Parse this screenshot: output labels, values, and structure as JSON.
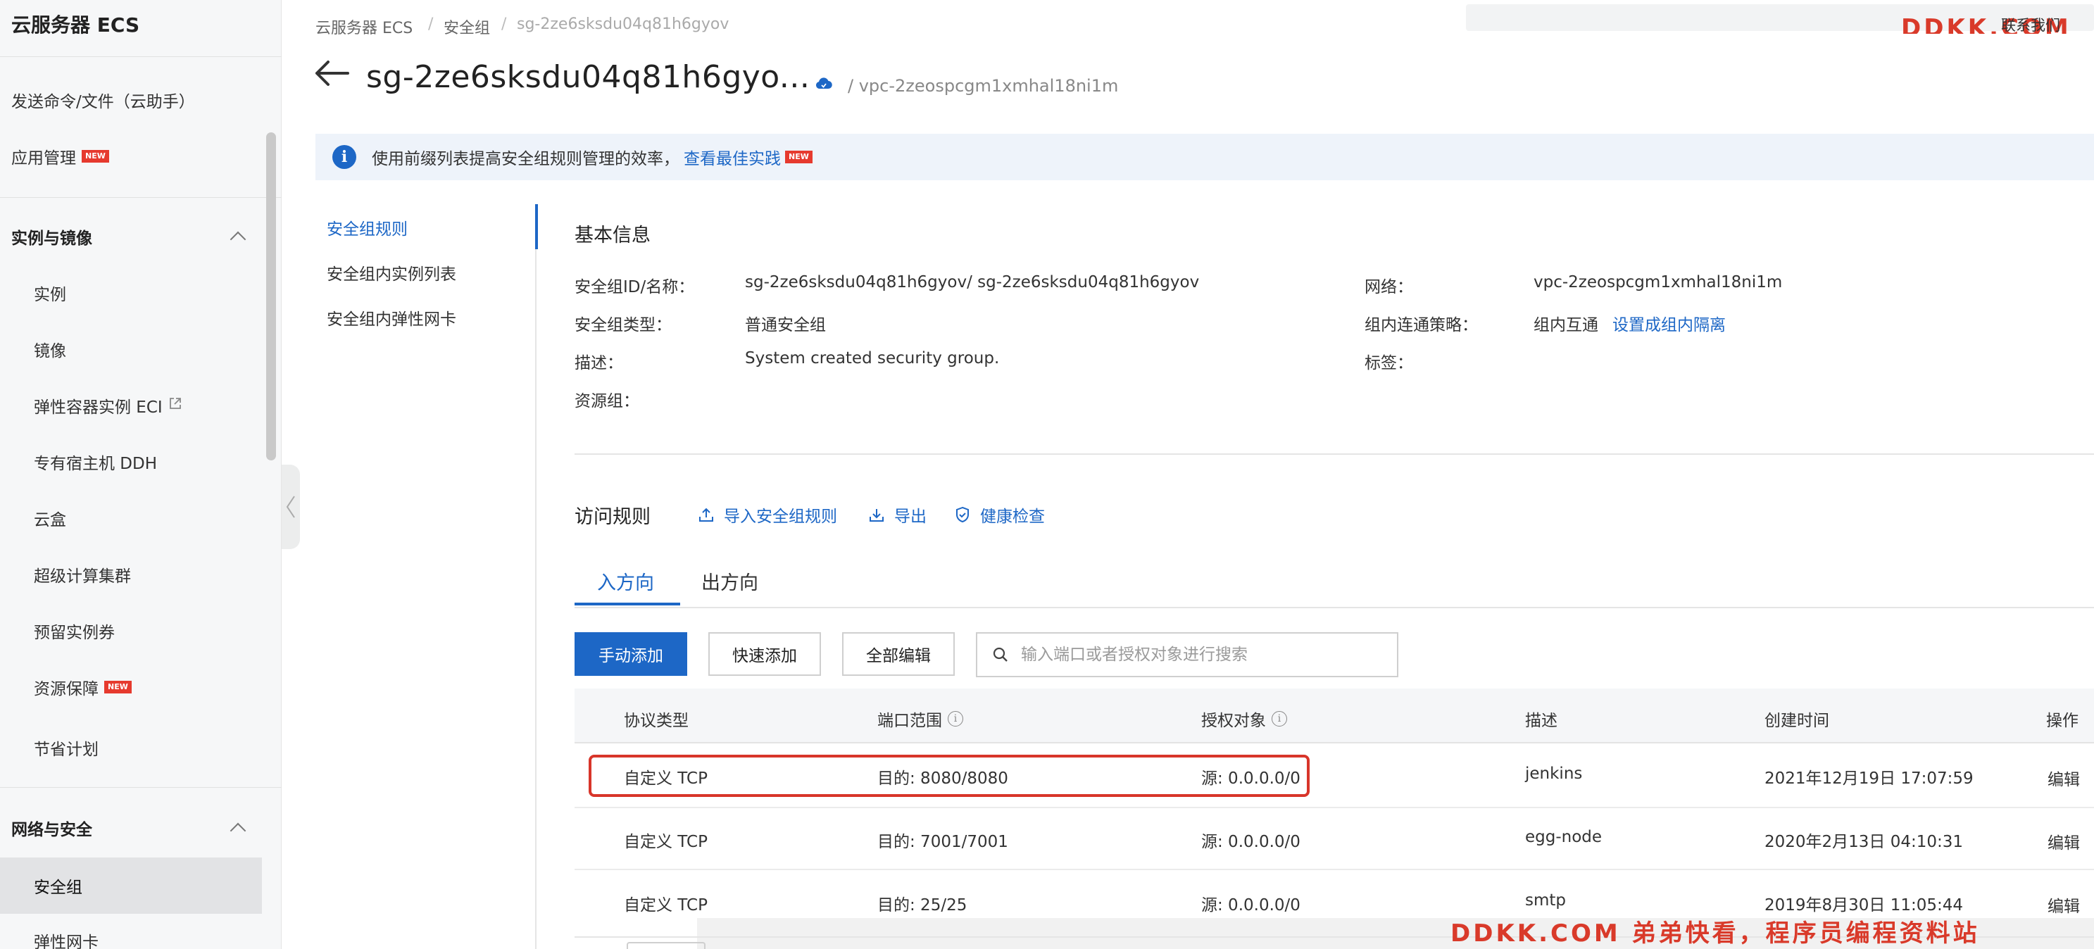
{
  "sidebar": {
    "title": "云服务器 ECS",
    "items_top": [
      {
        "label": "发送命令/文件（云助手）"
      },
      {
        "label": "应用管理",
        "badge": "NEW"
      }
    ],
    "group_instances": {
      "label": "实例与镜像",
      "items": [
        {
          "label": "实例"
        },
        {
          "label": "镜像"
        },
        {
          "label": "弹性容器实例 ECI"
        },
        {
          "label": "专有宿主机 DDH"
        },
        {
          "label": "云盒"
        },
        {
          "label": "超级计算集群"
        },
        {
          "label": "预留实例券"
        },
        {
          "label": "资源保障",
          "badge": "NEW"
        },
        {
          "label": "节省计划"
        }
      ]
    },
    "group_network": {
      "label": "网络与安全",
      "items": [
        {
          "label": "安全组"
        },
        {
          "label": "弹性网卡"
        }
      ]
    }
  },
  "breadcrumb": [
    "云服务器 ECS",
    "安全组",
    "sg-2ze6sksdu04q81h6gyov"
  ],
  "breadcrumb_sep": "/",
  "header": {
    "title": "sg-2ze6sksdu04q81h6gyo...",
    "vpc": "/ vpc-2zeospcgm1xmhal18ni1m",
    "top_right_text": "联系我们"
  },
  "notice": {
    "text": "使用前缀列表提高安全组规则管理的效率，",
    "link": "查看最佳实践",
    "badge": "NEW"
  },
  "subnav": [
    "安全组规则",
    "安全组内实例列表",
    "安全组内弹性网卡"
  ],
  "basic_info": {
    "title": "基本信息",
    "fields_left": [
      {
        "label": "安全组ID/名称：",
        "value": "sg-2ze6sksdu04q81h6gyov/ sg-2ze6sksdu04q81h6gyov"
      },
      {
        "label": "安全组类型：",
        "value": "普通安全组"
      },
      {
        "label": "描述：",
        "value": "System created security group."
      },
      {
        "label": "资源组：",
        "value": ""
      }
    ],
    "fields_right": [
      {
        "label": "网络：",
        "value": "vpc-2zeospcgm1xmhal18ni1m"
      },
      {
        "label": "组内连通策略：",
        "value": "组内互通",
        "link": "设置成组内隔离"
      },
      {
        "label": "标签：",
        "value": ""
      }
    ]
  },
  "rules": {
    "title": "访问规则",
    "tools": [
      "导入安全组规则",
      "导出",
      "健康检查"
    ],
    "tabs": [
      "入方向",
      "出方向"
    ],
    "buttons": {
      "manual_add": "手动添加",
      "quick_add": "快速添加",
      "edit_all": "全部编辑"
    },
    "search_placeholder": "输入端口或者授权对象进行搜索",
    "columns": [
      "协议类型",
      "端口范围",
      "授权对象",
      "描述",
      "创建时间",
      "操作"
    ],
    "rows": [
      {
        "protocol": "自定义 TCP",
        "port": "目的: 8080/8080",
        "source": "源: 0.0.0.0/0",
        "desc": "jenkins",
        "created": "2021年12月19日 17:07:59",
        "action": "编辑"
      },
      {
        "protocol": "自定义 TCP",
        "port": "目的: 7001/7001",
        "source": "源: 0.0.0.0/0",
        "desc": "egg-node",
        "created": "2020年2月13日 04:10:31",
        "action": "编辑"
      },
      {
        "protocol": "自定义 TCP",
        "port": "目的: 25/25",
        "source": "源: 0.0.0.0/0",
        "desc": "smtp",
        "created": "2019年8月30日 11:05:44",
        "action": "编辑"
      }
    ]
  },
  "watermarks": {
    "top": "DDKK.COM",
    "bottom": "DDKK.COM 弟弟快看，程序员编程资料站"
  },
  "colors": {
    "accent": "#1d67c6",
    "highlight_border": "#d8352a",
    "badge": "#e63a2e"
  },
  "icons": [
    "back-arrow-icon",
    "cloud-icon",
    "info-icon",
    "upload-icon",
    "download-icon",
    "shield-check-icon",
    "search-icon",
    "question-circle-icon",
    "chevron-up-icon",
    "external-link-icon"
  ]
}
